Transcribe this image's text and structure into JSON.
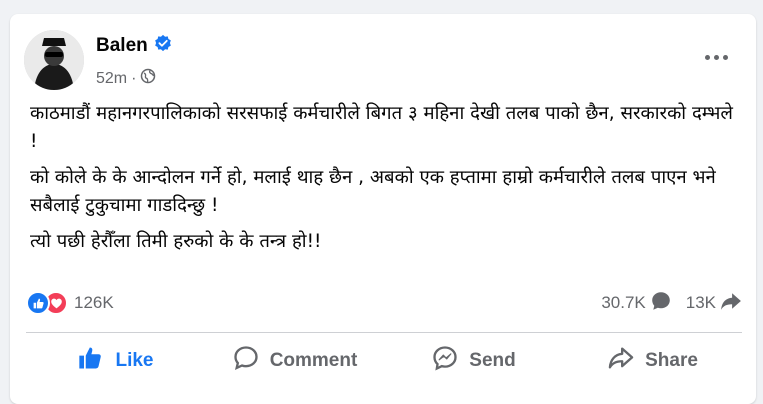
{
  "post": {
    "author": "Balen",
    "time": "52m",
    "separator": "·",
    "paragraphs": [
      "काठमाडौं महानगरपालिकाको सरसफाई कर्मचारीले बिगत ३ महिना देखी तलब पाको छैन, सरकारको दम्भले !",
      "को कोले के के आन्दोलन गर्ने हो, मलाई थाह छैन , अबको एक हप्तामा हाम्रो कर्मचारीले तलब पाएन भने सबैलाई टुकुचामा गाडदिन्छु !",
      "त्यो पछी हेरौँला तिमी हरुको के के तन्त्र हो!!"
    ]
  },
  "stats": {
    "reactions": "126K",
    "comments": "30.7K",
    "shares": "13K"
  },
  "actions": {
    "like": "Like",
    "comment": "Comment",
    "send": "Send",
    "share": "Share"
  },
  "colors": {
    "accent": "#1877f2",
    "love": "#f33e58",
    "muted": "#65676b"
  },
  "icons": [
    "verified-icon",
    "globe-icon",
    "more-icon",
    "like-reaction-icon",
    "love-reaction-icon",
    "comment-icon",
    "share-icon",
    "like-icon",
    "send-icon"
  ]
}
